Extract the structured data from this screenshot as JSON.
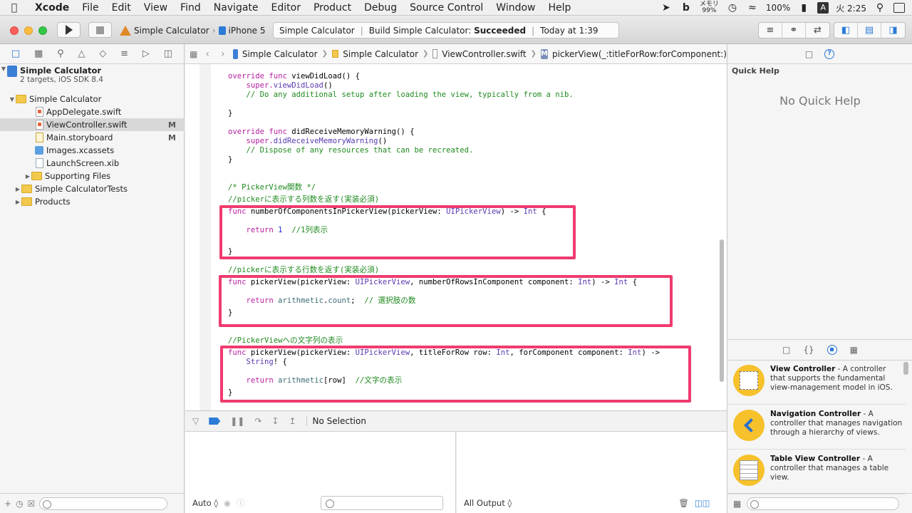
{
  "menubar": {
    "items": [
      "Xcode",
      "File",
      "Edit",
      "View",
      "Find",
      "Navigate",
      "Editor",
      "Product",
      "Debug",
      "Source Control",
      "Window",
      "Help"
    ],
    "memory_label": "メモリ",
    "memory_value": "99%",
    "battery": "100%",
    "input_method": "A",
    "clock": "火 2:25"
  },
  "toolbar": {
    "scheme_target": "Simple Calculator",
    "scheme_device": "iPhone 5",
    "activity_project": "Simple Calculator",
    "activity_build_prefix": "Build Simple Calculator:",
    "activity_build_status": "Succeeded",
    "activity_time": "Today at 1:39"
  },
  "navigator": {
    "project_name": "Simple Calculator",
    "project_sub": "2 targets, iOS SDK 8.4",
    "items": [
      {
        "label": "Simple Calculator",
        "mark": ""
      },
      {
        "label": "AppDelegate.swift",
        "mark": ""
      },
      {
        "label": "ViewController.swift",
        "mark": "M"
      },
      {
        "label": "Main.storyboard",
        "mark": "M"
      },
      {
        "label": "Images.xcassets",
        "mark": ""
      },
      {
        "label": "LaunchScreen.xib",
        "mark": ""
      },
      {
        "label": "Supporting Files",
        "mark": ""
      },
      {
        "label": "Simple CalculatorTests",
        "mark": ""
      },
      {
        "label": "Products",
        "mark": ""
      }
    ]
  },
  "jumpbar": {
    "project": "Simple Calculator",
    "group": "Simple Calculator",
    "file": "ViewController.swift",
    "symbol": "pickerView(_:titleForRow:forComponent:)"
  },
  "code": {
    "l0a": "override func ",
    "l0b": "viewDidLoad() {",
    "l1a": "    super.",
    "l1b": "viewDidLoad",
    "l1c": "()",
    "l2": "    // Do any additional setup after loading the view, typically from a nib.",
    "l4": "}",
    "l6a": "override func ",
    "l6b": "didReceiveMemoryWarning() {",
    "l7a": "    super.",
    "l7b": "didReceiveMemoryWarning",
    "l7c": "()",
    "l8": "    // Dispose of any resources that can be recreated.",
    "l9": "}",
    "l11": "/* PickerView関数 */",
    "l12": "//pickerに表示する列数を返す(実装必須)",
    "l13a": "func ",
    "l13b": "numberOfComponentsInPickerView(pickerView: ",
    "l13c": "UIPickerView",
    "l13d": ") -> ",
    "l13e": "Int",
    "l13f": " {",
    "l15a": "    return ",
    "l15b": "1",
    "l15c": "  //1列表示",
    "l17": "}",
    "l19": "//pickerに表示する行数を返す(実装必須)",
    "l20a": "func ",
    "l20b": "pickerView(pickerView: ",
    "l20c": "UIPickerView",
    "l20d": ", numberOfRowsInComponent component: ",
    "l20e": "Int",
    "l20f": ") -> ",
    "l20g": "Int",
    "l20h": " {",
    "l22a": "    return ",
    "l22b": "arithmetic",
    "l22c": ".",
    "l22d": "count",
    "l22e": ";  ",
    "l22f": "// 選択肢の数",
    "l23": "}",
    "l25": "//PickerViewへの文字列の表示",
    "l26a": "func ",
    "l26b": "pickerView(pickerView: ",
    "l26c": "UIPickerView",
    "l26d": ", titleForRow row: ",
    "l26e": "Int",
    "l26f": ", forComponent component: ",
    "l26g": "Int",
    "l26h": ") ->",
    "l27a": "    ",
    "l27b": "String",
    "l27c": "! {",
    "l29a": "    return ",
    "l29b": "arithmetic",
    "l29c": "[row]  ",
    "l29d": "//文字の表示",
    "l30": "}"
  },
  "debug": {
    "selection": "No Selection",
    "auto_label": "Auto ◊",
    "output_label": "All Output ◊"
  },
  "utilities": {
    "quick_help_title": "Quick Help",
    "quick_help_empty": "No Quick Help",
    "library": [
      {
        "title": "View Controller",
        "desc": " - A controller that supports the fundamental view-management model in iOS."
      },
      {
        "title": "Navigation Controller",
        "desc": " - A controller that manages navigation through a hierarchy of views."
      },
      {
        "title": "Table View Controller",
        "desc": " - A controller that manages a table view."
      }
    ]
  },
  "colors": {
    "highlight_box": "#ef3b6e",
    "keyword": "#b520a0",
    "comment": "#1e8a1e",
    "type": "#5b3ab0",
    "accent": "#2b7bd6"
  }
}
